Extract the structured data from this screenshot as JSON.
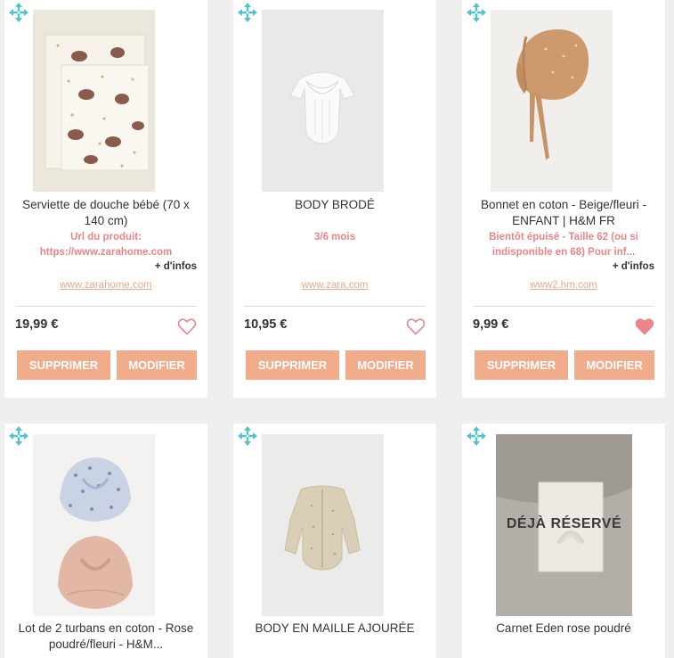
{
  "colors": {
    "accent": "#f0ac8b",
    "link": "#e9a98b",
    "note": "#e8868a",
    "heart": "#e8868a",
    "move_icon": "#4fc4cc"
  },
  "products": [
    {
      "title": "Serviette de douche bébé (70 x 140 cm)",
      "note": "Url du produit: https://www.zarahome.com",
      "more_info": "+ d'infos",
      "site": "www.zarahome.com",
      "price": "19,99 €",
      "favorite": false,
      "delete_label": "SUPPRIMER",
      "edit_label": "MODIFIER"
    },
    {
      "title": "BODY BRODÉ",
      "note": "3/6 mois",
      "site": "www.zara.com",
      "price": "10,95 €",
      "favorite": false,
      "delete_label": "SUPPRIMER",
      "edit_label": "MODIFIER"
    },
    {
      "title": "Bonnet en coton - Beige/fleuri - ENFANT | H&M FR",
      "note": "Bientôt épuisé - Taille 62 (ou si indisponible en 68) Pour inf...",
      "more_info": "+ d'infos",
      "site": "www2.hm.com",
      "price": "9,99 €",
      "favorite": true,
      "delete_label": "SUPPRIMER",
      "edit_label": "MODIFIER"
    },
    {
      "title": "Lot de 2 turbans en coton - Rose poudré/fleuri - H&M..."
    },
    {
      "title": "BODY EN MAILLE AJOURÉE"
    },
    {
      "title": "Carnet Eden rose poudré",
      "reserved_label": "DÉJÀ RÉSERVÉ"
    }
  ]
}
